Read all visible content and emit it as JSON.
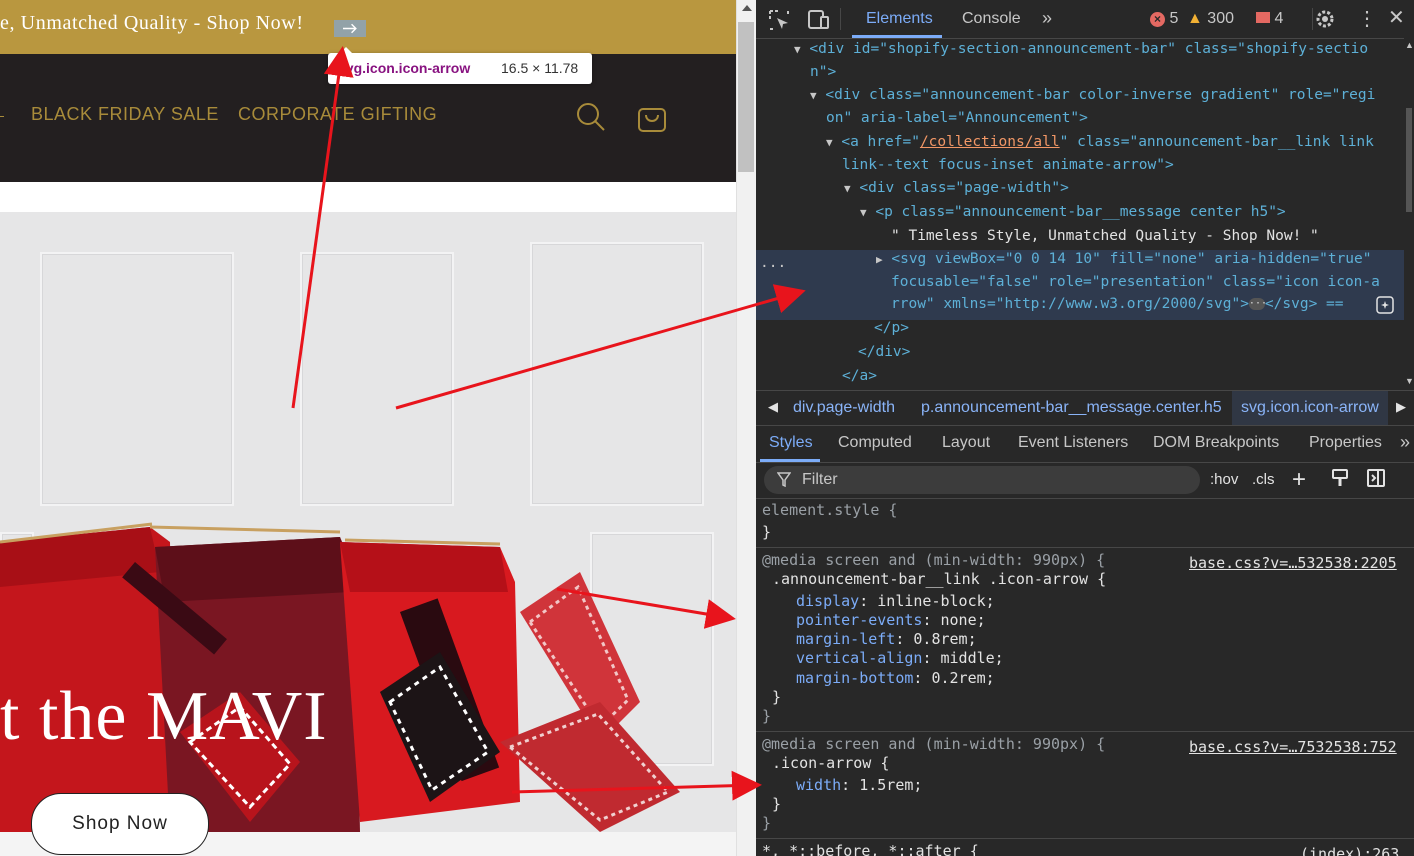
{
  "website": {
    "announcement_text": "e, Unmatched Quality - Shop Now!",
    "tooltip": {
      "selector": "svg.icon.icon-arrow",
      "size": "16.5 × 11.78"
    },
    "nav": {
      "black_friday": "BLACK FRIDAY SALE",
      "corporate_gifting": "CORPORATE GIFTING"
    },
    "hero": {
      "title": "t the MAVI",
      "button_label": "Shop Now"
    },
    "icons": [
      "arrow-right-icon",
      "search-icon",
      "cart-icon"
    ],
    "colors": {
      "announcement_bg": "#b9973f",
      "header_bg": "#231f20",
      "nav_text": "#a88b3a"
    }
  },
  "devtools": {
    "tabs": [
      "Elements",
      "Console"
    ],
    "active_tab": "Elements",
    "errors": "5",
    "warnings": "300",
    "issues": "4",
    "dom": {
      "l1a": "<div id=\"shopify-section-announcement-bar\" class=\"shopify-sectio",
      "l1b": "n\">",
      "l2a": "<div class=\"announcement-bar color-inverse gradient\" role=\"regi",
      "l2b": "on\" aria-label=\"Announcement\">",
      "l3a_pre": "<a href=\"",
      "l3a_link": "/collections/all",
      "l3a_post": "\" class=\"announcement-bar__link link",
      "l3b": "link--text focus-inset animate-arrow\">",
      "l4": "<div class=\"page-width\">",
      "l5": "<p class=\"announcement-bar__message center h5\">",
      "l6": "\" Timeless Style, Unmatched Quality - Shop Now! \"",
      "l7a": "<svg viewBox=\"0 0 14 10\" fill=\"none\" aria-hidden=\"true\"",
      "l7b": "focusable=\"false\" role=\"presentation\" class=\"icon icon-a",
      "l7c": "rrow\" xmlns=\"http://www.w3.org/2000/svg\">",
      "l7c_end": "</svg> ==",
      "l8": "</p>",
      "l9": "</div>",
      "l10": "</a>"
    },
    "breadcrumbs": [
      "div.page-width",
      "p.announcement-bar__message.center.h5",
      "svg.icon.icon-arrow"
    ],
    "subtabs": [
      "Styles",
      "Computed",
      "Layout",
      "Event Listeners",
      "DOM Breakpoints",
      "Properties"
    ],
    "filter_placeholder": "Filter",
    "hov": ":hov",
    "cls": ".cls",
    "styles": {
      "element_style": "element.style {",
      "close": "}",
      "media1": "@media screen and (min-width: 990px) {",
      "source1": "base.css?v=…532538:2205",
      "selector1": ".announcement-bar__link .icon-arrow {",
      "decls1": [
        {
          "prop": "display",
          "value": "inline-block;"
        },
        {
          "prop": "pointer-events",
          "value": "none;"
        },
        {
          "prop": "margin-left",
          "value": "0.8rem;"
        },
        {
          "prop": "vertical-align",
          "value": "middle;"
        },
        {
          "prop": "margin-bottom",
          "value": "0.2rem;"
        }
      ],
      "media2": "@media screen and (min-width: 990px) {",
      "source2": "base.css?v=…7532538:752",
      "selector2": ".icon-arrow {",
      "decls2": [
        {
          "prop": "width",
          "value": "1.5rem;"
        }
      ],
      "last_rule": "*, *::before, *::after {",
      "last_source": "(index):263"
    }
  }
}
